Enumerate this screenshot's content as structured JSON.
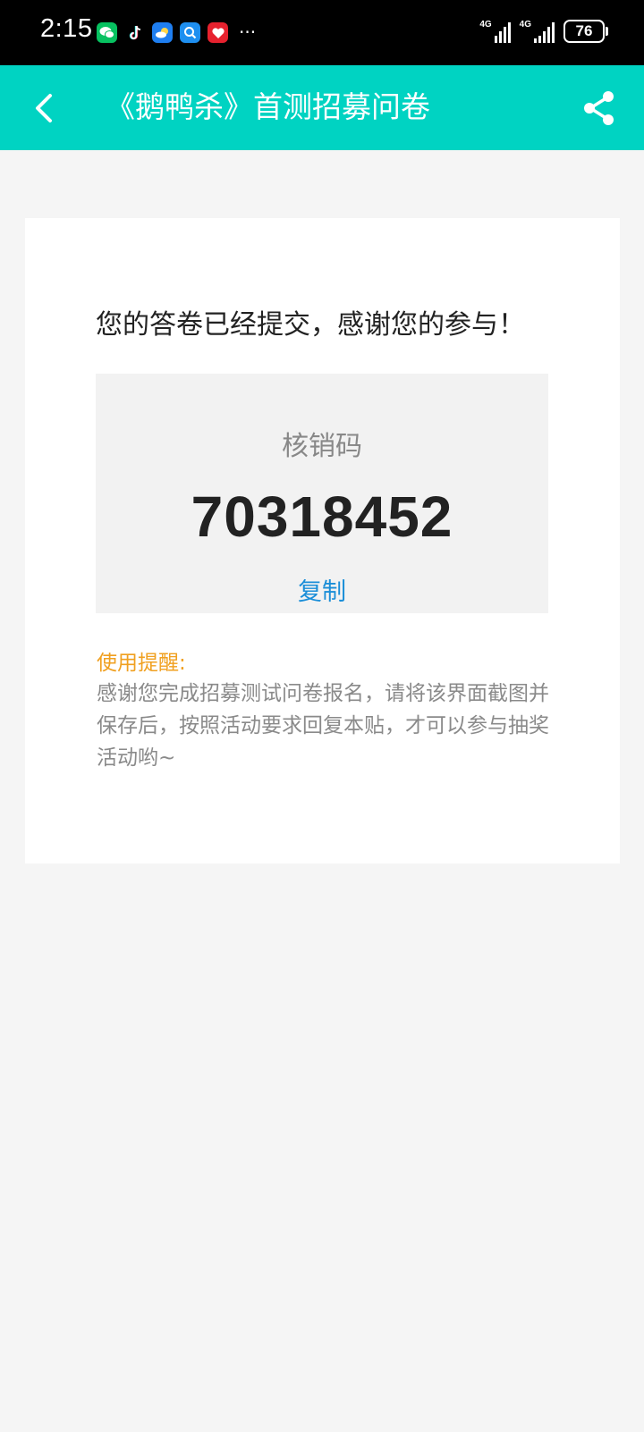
{
  "status_bar": {
    "time": "2:15",
    "network_1": "4G",
    "network_2": "4G",
    "battery": "76",
    "more": "···"
  },
  "app_bar": {
    "title": "《鹅鸭杀》首测招募问卷"
  },
  "card": {
    "success_message": "您的答卷已经提交，感谢您的参与！",
    "code_label": "核销码",
    "code_value": "70318452",
    "copy_label": "复制",
    "tip_title": "使用提醒:",
    "tip_body": "感谢您完成招募测试问卷报名，请将该界面截图并保存后，按照活动要求回复本贴，才可以参与抽奖活动哟~"
  },
  "colors": {
    "app_bar": "#00d3c2",
    "copy_link": "#1a8ed8",
    "tip_title": "#f0a020"
  }
}
